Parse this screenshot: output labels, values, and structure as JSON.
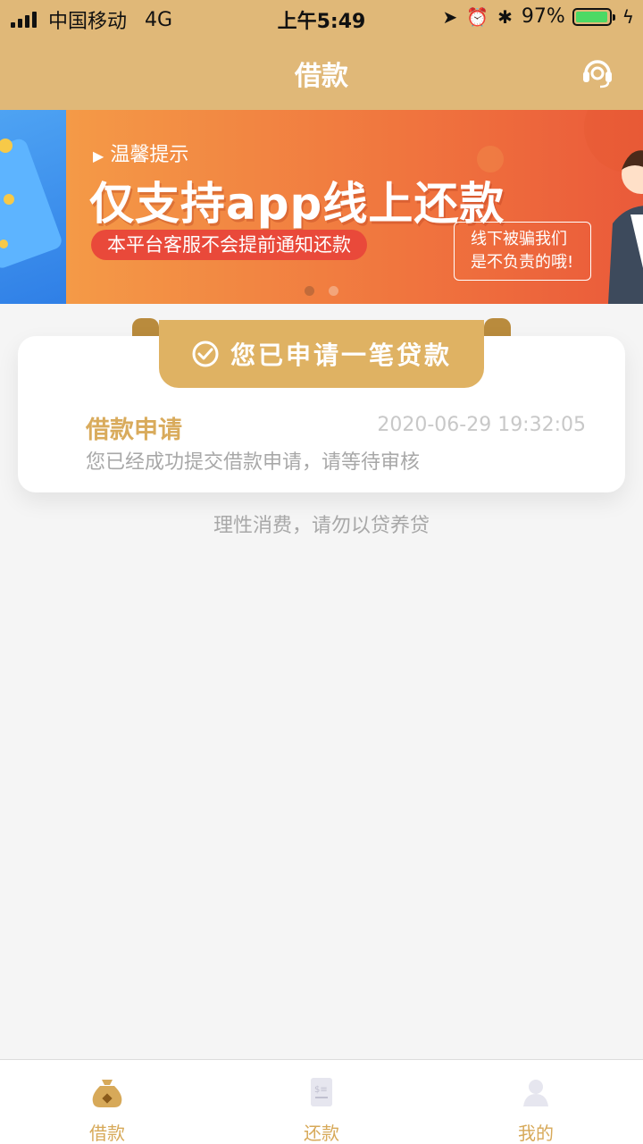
{
  "status_bar": {
    "carrier": "中国移动",
    "network": "4G",
    "time": "上午5:49",
    "battery_percent": "97%",
    "battery_level": 0.97
  },
  "header": {
    "title": "借款",
    "support_icon": "headset-icon"
  },
  "banner": {
    "hint": "温馨提示",
    "headline": "仅支持app线上还款",
    "pill_text": "本平台客服不会提前通知还款",
    "note_line1": "线下被骗我们",
    "note_line2": "是不负责的哦!",
    "page_indicator": {
      "count": 2,
      "active": 1
    }
  },
  "card": {
    "ribbon_text": "您已申请一笔贷款",
    "title": "借款申请",
    "time": "2020-06-29 19:32:05",
    "description": "您已经成功提交借款申请，请等待审核"
  },
  "advice": "理性消费，请勿以贷养贷",
  "tabs": [
    {
      "label": "借款",
      "icon": "money-bag-icon",
      "active": true
    },
    {
      "label": "还款",
      "icon": "bill-icon",
      "active": false
    },
    {
      "label": "我的",
      "icon": "user-icon",
      "active": false
    }
  ],
  "colors": {
    "brand_gold": "#e0b878",
    "accent_gold": "#d9ab5c",
    "banner_orange": "#f0743e",
    "battery_green": "#4cd964"
  }
}
